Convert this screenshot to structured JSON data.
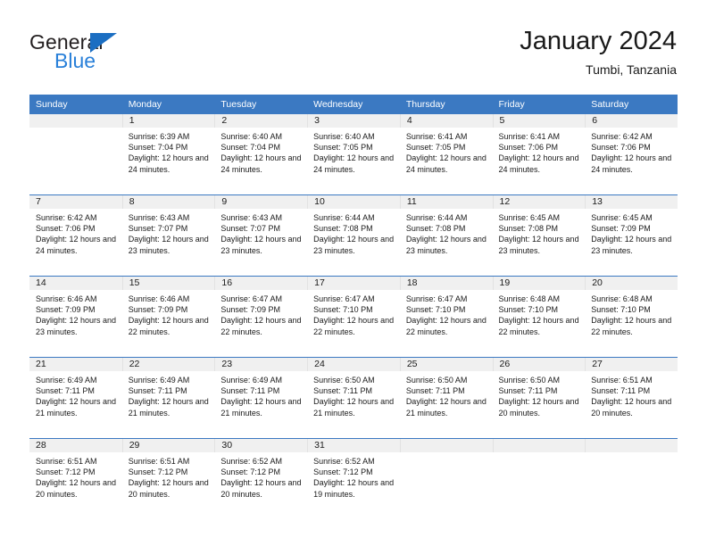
{
  "brand": {
    "name_top": "General",
    "name_bottom": "Blue",
    "accent_color": "#2980d9",
    "triangle_color": "#1b6ec2"
  },
  "header": {
    "title": "January 2024",
    "subtitle": "Tumbi, Tanzania"
  },
  "theme": {
    "header_blue": "#3b79c2",
    "daynum_band": "#f0f0f0",
    "text": "#1a1a1a"
  },
  "weekday_headers": [
    "Sunday",
    "Monday",
    "Tuesday",
    "Wednesday",
    "Thursday",
    "Friday",
    "Saturday"
  ],
  "labels": {
    "sunrise_prefix": "Sunrise: ",
    "sunset_prefix": "Sunset: ",
    "daylight_prefix": "Daylight: "
  },
  "weeks": [
    [
      {
        "empty": true
      },
      {
        "day": "1",
        "sunrise": "Sunrise: 6:39 AM",
        "sunset": "Sunset: 7:04 PM",
        "daylight": "Daylight: 12 hours and 24 minutes."
      },
      {
        "day": "2",
        "sunrise": "Sunrise: 6:40 AM",
        "sunset": "Sunset: 7:04 PM",
        "daylight": "Daylight: 12 hours and 24 minutes."
      },
      {
        "day": "3",
        "sunrise": "Sunrise: 6:40 AM",
        "sunset": "Sunset: 7:05 PM",
        "daylight": "Daylight: 12 hours and 24 minutes."
      },
      {
        "day": "4",
        "sunrise": "Sunrise: 6:41 AM",
        "sunset": "Sunset: 7:05 PM",
        "daylight": "Daylight: 12 hours and 24 minutes."
      },
      {
        "day": "5",
        "sunrise": "Sunrise: 6:41 AM",
        "sunset": "Sunset: 7:06 PM",
        "daylight": "Daylight: 12 hours and 24 minutes."
      },
      {
        "day": "6",
        "sunrise": "Sunrise: 6:42 AM",
        "sunset": "Sunset: 7:06 PM",
        "daylight": "Daylight: 12 hours and 24 minutes."
      }
    ],
    [
      {
        "day": "7",
        "sunrise": "Sunrise: 6:42 AM",
        "sunset": "Sunset: 7:06 PM",
        "daylight": "Daylight: 12 hours and 24 minutes."
      },
      {
        "day": "8",
        "sunrise": "Sunrise: 6:43 AM",
        "sunset": "Sunset: 7:07 PM",
        "daylight": "Daylight: 12 hours and 23 minutes."
      },
      {
        "day": "9",
        "sunrise": "Sunrise: 6:43 AM",
        "sunset": "Sunset: 7:07 PM",
        "daylight": "Daylight: 12 hours and 23 minutes."
      },
      {
        "day": "10",
        "sunrise": "Sunrise: 6:44 AM",
        "sunset": "Sunset: 7:08 PM",
        "daylight": "Daylight: 12 hours and 23 minutes."
      },
      {
        "day": "11",
        "sunrise": "Sunrise: 6:44 AM",
        "sunset": "Sunset: 7:08 PM",
        "daylight": "Daylight: 12 hours and 23 minutes."
      },
      {
        "day": "12",
        "sunrise": "Sunrise: 6:45 AM",
        "sunset": "Sunset: 7:08 PM",
        "daylight": "Daylight: 12 hours and 23 minutes."
      },
      {
        "day": "13",
        "sunrise": "Sunrise: 6:45 AM",
        "sunset": "Sunset: 7:09 PM",
        "daylight": "Daylight: 12 hours and 23 minutes."
      }
    ],
    [
      {
        "day": "14",
        "sunrise": "Sunrise: 6:46 AM",
        "sunset": "Sunset: 7:09 PM",
        "daylight": "Daylight: 12 hours and 23 minutes."
      },
      {
        "day": "15",
        "sunrise": "Sunrise: 6:46 AM",
        "sunset": "Sunset: 7:09 PM",
        "daylight": "Daylight: 12 hours and 22 minutes."
      },
      {
        "day": "16",
        "sunrise": "Sunrise: 6:47 AM",
        "sunset": "Sunset: 7:09 PM",
        "daylight": "Daylight: 12 hours and 22 minutes."
      },
      {
        "day": "17",
        "sunrise": "Sunrise: 6:47 AM",
        "sunset": "Sunset: 7:10 PM",
        "daylight": "Daylight: 12 hours and 22 minutes."
      },
      {
        "day": "18",
        "sunrise": "Sunrise: 6:47 AM",
        "sunset": "Sunset: 7:10 PM",
        "daylight": "Daylight: 12 hours and 22 minutes."
      },
      {
        "day": "19",
        "sunrise": "Sunrise: 6:48 AM",
        "sunset": "Sunset: 7:10 PM",
        "daylight": "Daylight: 12 hours and 22 minutes."
      },
      {
        "day": "20",
        "sunrise": "Sunrise: 6:48 AM",
        "sunset": "Sunset: 7:10 PM",
        "daylight": "Daylight: 12 hours and 22 minutes."
      }
    ],
    [
      {
        "day": "21",
        "sunrise": "Sunrise: 6:49 AM",
        "sunset": "Sunset: 7:11 PM",
        "daylight": "Daylight: 12 hours and 21 minutes."
      },
      {
        "day": "22",
        "sunrise": "Sunrise: 6:49 AM",
        "sunset": "Sunset: 7:11 PM",
        "daylight": "Daylight: 12 hours and 21 minutes."
      },
      {
        "day": "23",
        "sunrise": "Sunrise: 6:49 AM",
        "sunset": "Sunset: 7:11 PM",
        "daylight": "Daylight: 12 hours and 21 minutes."
      },
      {
        "day": "24",
        "sunrise": "Sunrise: 6:50 AM",
        "sunset": "Sunset: 7:11 PM",
        "daylight": "Daylight: 12 hours and 21 minutes."
      },
      {
        "day": "25",
        "sunrise": "Sunrise: 6:50 AM",
        "sunset": "Sunset: 7:11 PM",
        "daylight": "Daylight: 12 hours and 21 minutes."
      },
      {
        "day": "26",
        "sunrise": "Sunrise: 6:50 AM",
        "sunset": "Sunset: 7:11 PM",
        "daylight": "Daylight: 12 hours and 20 minutes."
      },
      {
        "day": "27",
        "sunrise": "Sunrise: 6:51 AM",
        "sunset": "Sunset: 7:11 PM",
        "daylight": "Daylight: 12 hours and 20 minutes."
      }
    ],
    [
      {
        "day": "28",
        "sunrise": "Sunrise: 6:51 AM",
        "sunset": "Sunset: 7:12 PM",
        "daylight": "Daylight: 12 hours and 20 minutes."
      },
      {
        "day": "29",
        "sunrise": "Sunrise: 6:51 AM",
        "sunset": "Sunset: 7:12 PM",
        "daylight": "Daylight: 12 hours and 20 minutes."
      },
      {
        "day": "30",
        "sunrise": "Sunrise: 6:52 AM",
        "sunset": "Sunset: 7:12 PM",
        "daylight": "Daylight: 12 hours and 20 minutes."
      },
      {
        "day": "31",
        "sunrise": "Sunrise: 6:52 AM",
        "sunset": "Sunset: 7:12 PM",
        "daylight": "Daylight: 12 hours and 19 minutes."
      },
      {
        "empty": true
      },
      {
        "empty": true
      },
      {
        "empty": true
      }
    ]
  ]
}
